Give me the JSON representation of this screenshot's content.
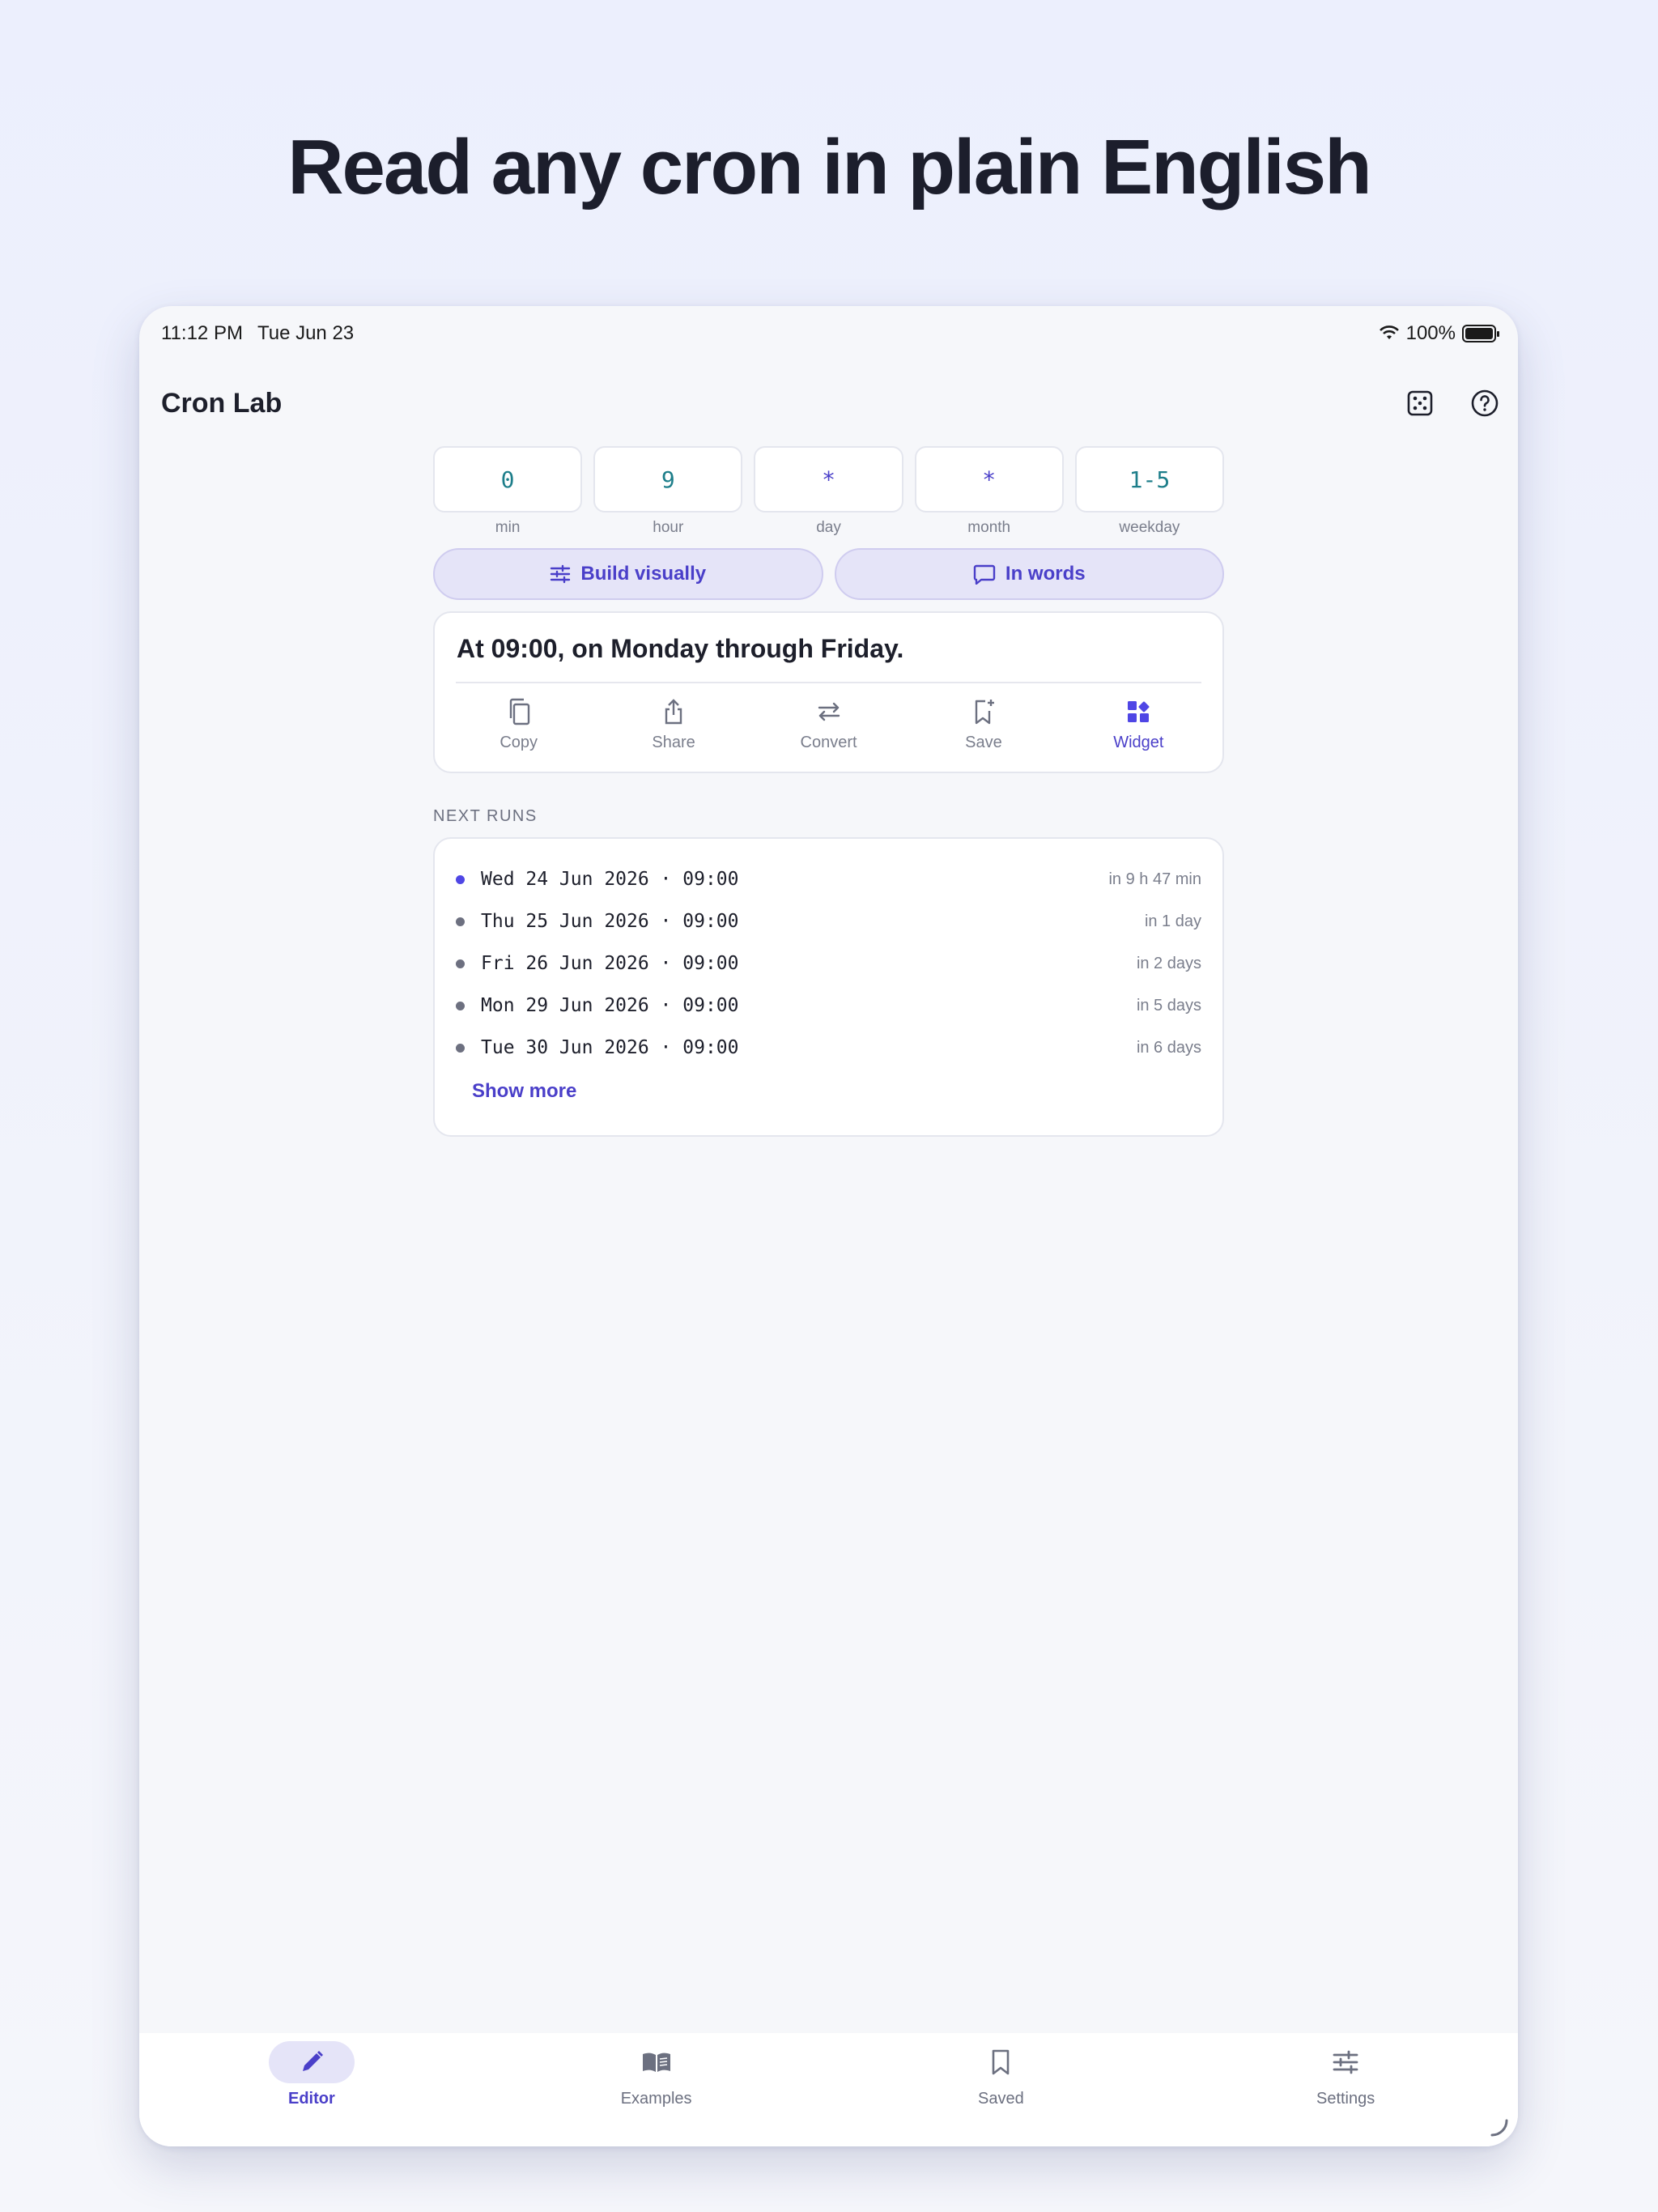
{
  "headline": "Read any cron in plain English",
  "status": {
    "time": "11:12 PM",
    "date": "Tue Jun 23",
    "battery": "100%"
  },
  "appbar": {
    "title": "Cron Lab",
    "actions": [
      "dice-icon",
      "help-icon"
    ]
  },
  "fields": [
    {
      "value": "0",
      "label": "min"
    },
    {
      "value": "9",
      "label": "hour"
    },
    {
      "value": "*",
      "label": "day"
    },
    {
      "value": "*",
      "label": "month"
    },
    {
      "value": "1-5",
      "label": "weekday"
    }
  ],
  "modes": {
    "build": "Build visually",
    "words": "In words"
  },
  "description": "At 09:00, on Monday through Friday.",
  "actions": [
    {
      "label": "Copy",
      "icon": "copy-icon"
    },
    {
      "label": "Share",
      "icon": "share-icon"
    },
    {
      "label": "Convert",
      "icon": "convert-icon"
    },
    {
      "label": "Save",
      "icon": "bookmark-add-icon"
    },
    {
      "label": "Widget",
      "icon": "widget-icon"
    }
  ],
  "next_runs": {
    "title": "NEXT RUNS",
    "items": [
      {
        "when": "Wed 24 Jun 2026 · 09:00",
        "rel": "in 9 h 47 min"
      },
      {
        "when": "Thu 25 Jun 2026 · 09:00",
        "rel": "in 1 day"
      },
      {
        "when": "Fri 26 Jun 2026 · 09:00",
        "rel": "in 2 days"
      },
      {
        "when": "Mon 29 Jun 2026 · 09:00",
        "rel": "in 5 days"
      },
      {
        "when": "Tue 30 Jun 2026 · 09:00",
        "rel": "in 6 days"
      }
    ],
    "show_more": "Show more"
  },
  "tabs": [
    {
      "label": "Editor",
      "icon": "pencil-icon"
    },
    {
      "label": "Examples",
      "icon": "book-icon"
    },
    {
      "label": "Saved",
      "icon": "bookmark-icon"
    },
    {
      "label": "Settings",
      "icon": "sliders-icon"
    }
  ],
  "colors": {
    "accent": "#4a3fc9",
    "accent_bg": "#e5e4f8",
    "field_value": "#1d7e8a"
  }
}
